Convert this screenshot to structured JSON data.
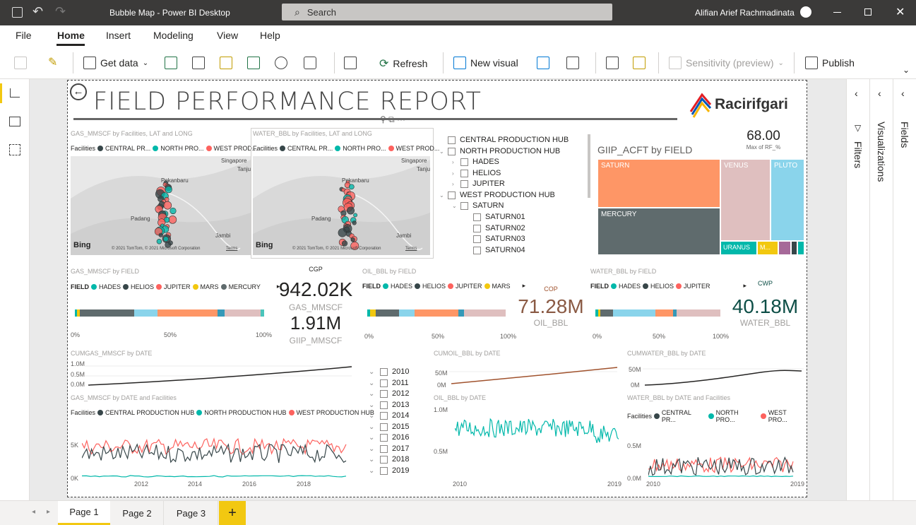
{
  "window": {
    "title": "Bubble Map - Power BI Desktop",
    "search_placeholder": "Search",
    "user": "Alifian Arief Rachmadinata"
  },
  "ribbon": {
    "tabs": [
      "File",
      "Home",
      "Insert",
      "Modeling",
      "View",
      "Help"
    ],
    "get_data": "Get data",
    "refresh": "Refresh",
    "new_visual": "New visual",
    "sensitivity": "Sensitivity (preview)",
    "publish": "Publish"
  },
  "report": {
    "title": "FIELD PERFORMANCE REPORT",
    "logo_text": "Racirifgari",
    "map1": {
      "title": "GAS_MMSCF by Facilities, LAT and LONG",
      "legend_label": "Facilities",
      "series": [
        "CENTRAL PR...",
        "NORTH PRO...",
        "WEST PROD..."
      ],
      "places": [
        "Pekanbaru",
        "Singapore",
        "Tanju",
        "Padang",
        "Jambi"
      ],
      "bing": "Bing",
      "copyright": "© 2021 TomTom, © 2021 Microsoft Corporation",
      "terms": "Terms"
    },
    "map2": {
      "title": "WATER_BBL by Facilities, LAT and LONG",
      "legend_label": "Facilities",
      "series": [
        "CENTRAL PR...",
        "NORTH PRO...",
        "WEST PROD..."
      ],
      "places": [
        "Pekanbaru",
        "Singapore",
        "Tanju",
        "Padang",
        "Jambi"
      ],
      "bing": "Bing",
      "copyright": "© 2021 TomTom, © 2021 Microsoft Corporation",
      "terms": "Terms"
    },
    "slicer_hubs": [
      "CENTRAL PRODUCTION HUB",
      "NORTH PRODUCTION HUB",
      "HADES",
      "HELIOS",
      "JUPITER",
      "WEST PRODUCTION HUB",
      "SATURN",
      "SATURN01",
      "SATURN02",
      "SATURN03",
      "SATURN04"
    ],
    "kpi_rf": {
      "value": "68.00",
      "label": "Max of RF_%"
    },
    "treemap": {
      "title": "GIIP_ACFT by FIELD",
      "labels": [
        "SATURN",
        "VENUS",
        "PLUTO",
        "MERCURY",
        "URANUS",
        "M..."
      ]
    },
    "gas_bar": {
      "title": "GAS_MMSCF by FIELD",
      "legend_label": "FIELD",
      "series": [
        "HADES",
        "HELIOS",
        "JUPITER",
        "MARS",
        "MERCURY"
      ],
      "ticks": [
        "0%",
        "50%",
        "100%"
      ]
    },
    "cgp": {
      "label": "CGP",
      "value": "942.02K",
      "sublabel": "GAS_MMSCF",
      "value2": "1.91M",
      "sublabel2": "GIIP_MMSCF"
    },
    "oil_bar": {
      "title": "OIL_BBL by FIELD",
      "legend_label": "FIELD",
      "series": [
        "HADES",
        "HELIOS",
        "JUPITER",
        "MARS"
      ],
      "ticks": [
        "0%",
        "50%",
        "100%"
      ]
    },
    "cop": {
      "label": "COP",
      "value": "71.28M",
      "sublabel": "OIL_BBL"
    },
    "water_bar": {
      "title": "WATER_BBL by FIELD",
      "legend_label": "FIELD",
      "series": [
        "HADES",
        "HELIOS",
        "JUPITER"
      ],
      "ticks": [
        "0%",
        "50%",
        "100%"
      ]
    },
    "cwp": {
      "label": "CWP",
      "value": "40.18M",
      "sublabel": "WATER_BBL"
    },
    "cumgas": {
      "title": "CUMGAS_MMSCF by DATE",
      "yticks": [
        "1.0M",
        "0.5M",
        "0.0M"
      ]
    },
    "cumoil": {
      "title": "CUMOIL_BBL by DATE",
      "yticks": [
        "50M",
        "0M"
      ]
    },
    "cumwater": {
      "title": "CUMWATER_BBL by DATE",
      "yticks": [
        "50M",
        "0M"
      ]
    },
    "years": [
      "2010",
      "2011",
      "2012",
      "2013",
      "2014",
      "2015",
      "2016",
      "2017",
      "2018",
      "2019"
    ],
    "gasline": {
      "title": "GAS_MMSCF by DATE and Facilities",
      "legend_label": "Facilities",
      "series": [
        "CENTRAL PRODUCTION HUB",
        "NORTH PRODUCTION HUB",
        "WEST PRODUCTION HUB"
      ],
      "yticks": [
        "5K",
        "0K"
      ],
      "xticks": [
        "2012",
        "2014",
        "2016",
        "2018"
      ]
    },
    "oilline": {
      "title": "OIL_BBL by DATE",
      "yticks": [
        "1.0M",
        "0.5M"
      ],
      "xticks": [
        "2010",
        "2019"
      ]
    },
    "waterline": {
      "title": "WATER_BBL by DATE and Facilities",
      "legend_label": "Facilities",
      "series": [
        "CENTRAL PR...",
        "NORTH PRO...",
        "WEST PRO..."
      ],
      "yticks": [
        "0.5M",
        "0.0M"
      ],
      "xticks": [
        "2010",
        "2019"
      ]
    }
  },
  "panes": {
    "filters": "Filters",
    "visualizations": "Visualizations",
    "fields": "Fields"
  },
  "pages": [
    "Page 1",
    "Page 2",
    "Page 3"
  ],
  "colors": {
    "central": "#374649",
    "north": "#01b8aa",
    "west": "#fd625e",
    "mars": "#f2c80f",
    "orange": "#fe9666",
    "pink": "#dfbfbf",
    "skyblue": "#8ad4eb",
    "cop": "#8a5a44",
    "cwp": "#0e4f47"
  }
}
